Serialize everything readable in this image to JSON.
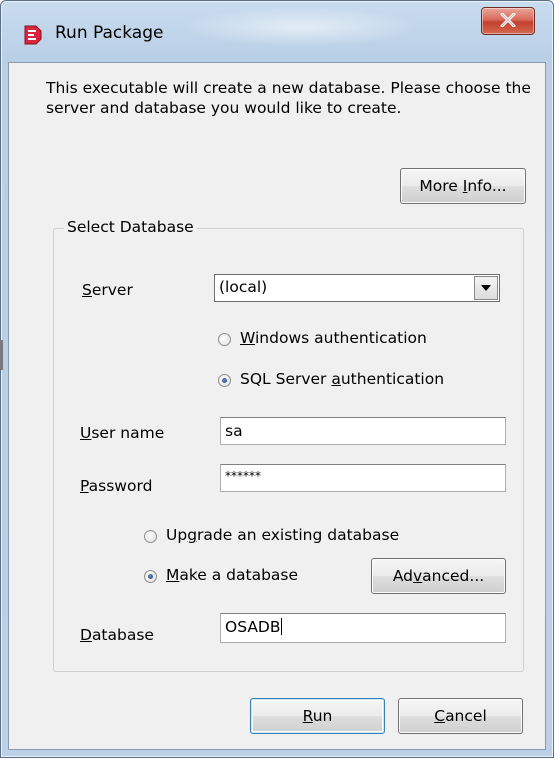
{
  "window": {
    "title": "Run Package",
    "blurred_title_text": "Package"
  },
  "intro_text": "This executable will create a new database. Please choose the server and database you would like to create.",
  "buttons": {
    "more_info_pre": "More ",
    "more_info_ul": "I",
    "more_info_post": "nfo...",
    "advanced_pre": "Ad",
    "advanced_ul": "v",
    "advanced_post": "anced...",
    "run_ul": "R",
    "run_post": "un",
    "cancel_ul": "C",
    "cancel_post": "ancel"
  },
  "group": {
    "title": "Select Database"
  },
  "server": {
    "label_ul": "S",
    "label_post": "erver",
    "value": "(local)"
  },
  "auth": {
    "windows_ul": "W",
    "windows_post": "indows authentication",
    "sql_pre": "SQL Server ",
    "sql_ul": "a",
    "sql_post": "uthentication",
    "selected": "sql"
  },
  "username": {
    "label_ul": "U",
    "label_post": "ser name",
    "value": "sa"
  },
  "password": {
    "label_ul": "P",
    "label_post": "assword",
    "value": "******"
  },
  "db_mode": {
    "upgrade_pre": "Up",
    "upgrade_ul": "g",
    "upgrade_post": "rade an existing database",
    "make_ul": "M",
    "make_post": "ake a database",
    "selected": "make"
  },
  "database": {
    "label_ul": "D",
    "label_post": "atabase",
    "value": "OSADB"
  },
  "colors": {
    "client_bg": "#f0f0f0",
    "close_red": "#c2402f",
    "frame_blue": "#bcd1e8"
  },
  "icons": [
    "app-icon",
    "close-icon",
    "dropdown-arrow-icon"
  ]
}
